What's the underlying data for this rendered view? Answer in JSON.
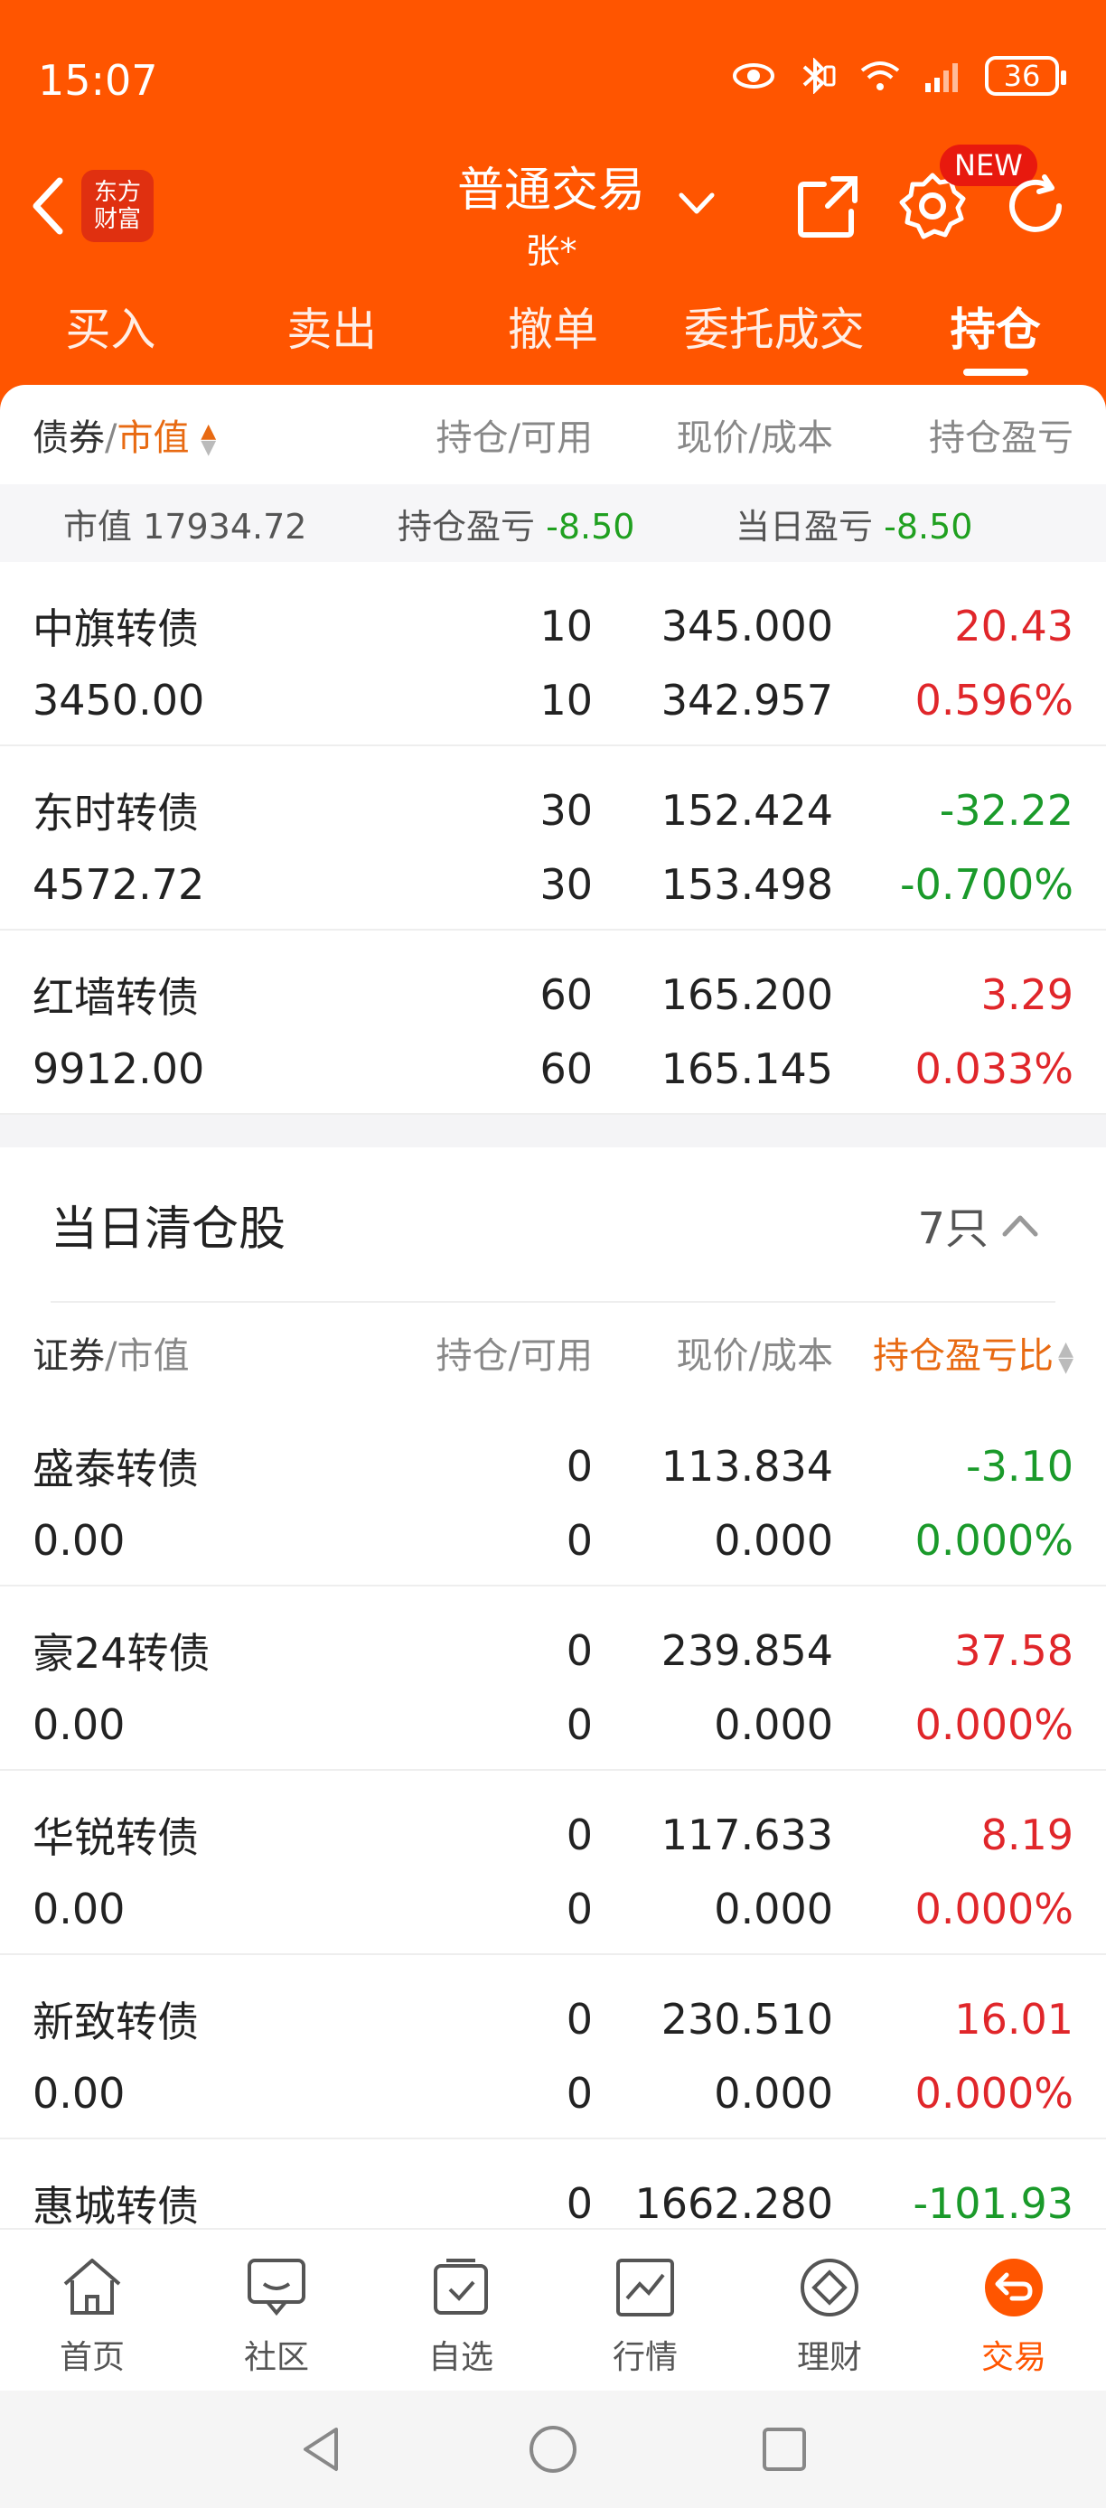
{
  "status": {
    "time": "15:07",
    "battery": "36"
  },
  "header": {
    "logo_line1": "东方",
    "logo_line2": "财富",
    "title": "普通交易",
    "subtitle": "张*",
    "new_badge": "NEW"
  },
  "tabs": [
    {
      "label": "买入"
    },
    {
      "label": "卖出"
    },
    {
      "label": "撤单"
    },
    {
      "label": "委托成交"
    },
    {
      "label": "持仓",
      "active": true
    }
  ],
  "holdings": {
    "columns": {
      "c1_dark": "债券",
      "c1_sep": "/",
      "c1_acc": "市值",
      "c2": "持仓/可用",
      "c3": "现价/成本",
      "c4": "持仓盈亏"
    },
    "summary": {
      "mv_label": "市值",
      "mv_value": "17934.72",
      "pl_label": "持仓盈亏",
      "pl_value": "-8.50",
      "day_label": "当日盈亏",
      "day_value": "-8.50"
    },
    "rows": [
      {
        "name": "中旗转债",
        "mv": "3450.00",
        "hold": "10",
        "avail": "10",
        "price": "345.000",
        "cost": "342.957",
        "pl": "20.43",
        "pct": "0.596%",
        "sign": "up"
      },
      {
        "name": "东时转债",
        "mv": "4572.72",
        "hold": "30",
        "avail": "30",
        "price": "152.424",
        "cost": "153.498",
        "pl": "-32.22",
        "pct": "-0.700%",
        "sign": "down"
      },
      {
        "name": "红墙转债",
        "mv": "9912.00",
        "hold": "60",
        "avail": "60",
        "price": "165.200",
        "cost": "165.145",
        "pl": "3.29",
        "pct": "0.033%",
        "sign": "up"
      }
    ]
  },
  "cleared": {
    "title": "当日清仓股",
    "count": "7只",
    "columns": {
      "c1_dark": "证券",
      "c1_sep": "/",
      "c1_acc": "市值",
      "c2": "持仓/可用",
      "c3": "现价/成本",
      "c4": "持仓盈亏比"
    },
    "rows": [
      {
        "name": "盛泰转债",
        "mv": "0.00",
        "hold": "0",
        "avail": "0",
        "price": "113.834",
        "cost": "0.000",
        "pl": "-3.10",
        "pct": "0.000%",
        "sign": "down"
      },
      {
        "name": "豪24转债",
        "mv": "0.00",
        "hold": "0",
        "avail": "0",
        "price": "239.854",
        "cost": "0.000",
        "pl": "37.58",
        "pct": "0.000%",
        "sign": "up"
      },
      {
        "name": "华锐转债",
        "mv": "0.00",
        "hold": "0",
        "avail": "0",
        "price": "117.633",
        "cost": "0.000",
        "pl": "8.19",
        "pct": "0.000%",
        "sign": "up"
      },
      {
        "name": "新致转债",
        "mv": "0.00",
        "hold": "0",
        "avail": "0",
        "price": "230.510",
        "cost": "0.000",
        "pl": "16.01",
        "pct": "0.000%",
        "sign": "up"
      },
      {
        "name": "惠城转债",
        "mv": "",
        "hold": "0",
        "avail": "",
        "price": "1662.280",
        "cost": "",
        "pl": "-101.93",
        "pct": "",
        "sign": "down"
      }
    ]
  },
  "bottom_nav": [
    {
      "label": "首页",
      "icon": "home-icon"
    },
    {
      "label": "社区",
      "icon": "community-icon"
    },
    {
      "label": "自选",
      "icon": "watchlist-icon"
    },
    {
      "label": "行情",
      "icon": "market-icon"
    },
    {
      "label": "理财",
      "icon": "finance-icon"
    },
    {
      "label": "交易",
      "icon": "trade-icon",
      "active": true
    }
  ],
  "colors": {
    "brand": "#ff5500",
    "up": "#e0262a",
    "down": "#1a9a2a",
    "accent": "#e86a12"
  }
}
